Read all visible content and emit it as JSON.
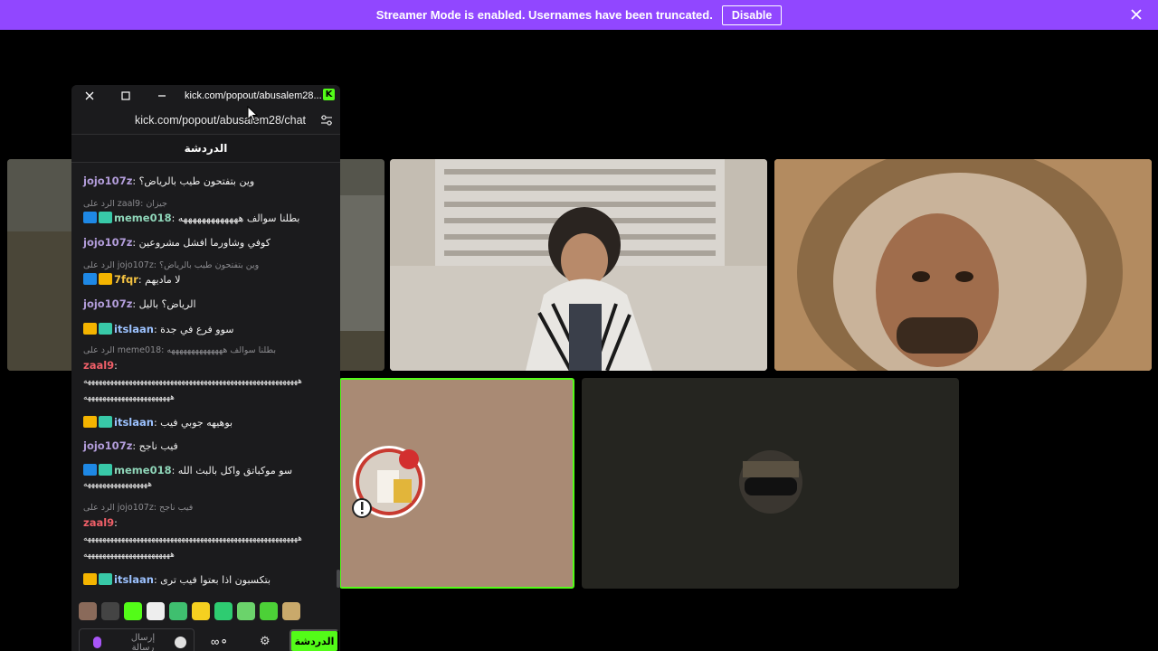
{
  "banner": {
    "message": "Streamer Mode is enabled. Usernames have been truncated.",
    "disable_label": "Disable",
    "color": "#9147ff"
  },
  "popout": {
    "window_title": "kick.com/popout/abusalem28...",
    "address": "kick.com/popout/abusalem28/chat",
    "chat_title": "الدردشة",
    "brand_color": "#53fc18"
  },
  "chat": {
    "messages": [
      {
        "user": "jojo107z",
        "text": "وين بتفتحون طيب بالرياض؟"
      },
      {
        "reply": "الرد على zaal9: جيزان"
      },
      {
        "user": "meme018",
        "text": "بطلنا سوالف هههههههههههههه"
      },
      {
        "user": "jojo107z",
        "text": "كوفي وشاورما افشل مشروعين"
      },
      {
        "reply": "الرد على jojo107z: وين بتفتحون طيب بالرياض؟"
      },
      {
        "user": "7fqr",
        "text": "لا ماديهم"
      },
      {
        "user": "jojo107z",
        "text": "الرياض؟ باليل"
      },
      {
        "user": "itslaan",
        "text": "سوو فرع في جدة"
      },
      {
        "reply": "الرد على meme018: بطلنا سوالف ههههههههههههههه"
      },
      {
        "user": "zaal9",
        "text": ""
      },
      {
        "long1": "هههههههههههههههههههههههههههههههههههههههههههههههههههههههههه"
      },
      {
        "long2": "هههههههههههههههههههههههه"
      },
      {
        "user": "itslaan",
        "text": "بوهيهه جوبي فيب"
      },
      {
        "user": "jojo107z",
        "text": "فيب ناجح"
      },
      {
        "user": "meme018",
        "text": "سو موكباتق واكل بالبث الله"
      },
      {
        "long3": "هههههههههههههههههه"
      },
      {
        "reply": "الرد على jojo107z: فيب ناجح"
      },
      {
        "user": "zaal9",
        "text": ""
      },
      {
        "long4": "هههههههههههههههههههههههههههههههههههههههههههههههههههههههههه"
      },
      {
        "long5": "هههههههههههههههههههههههه"
      },
      {
        "user": "itslaan",
        "text": "بتكسبون اذا بعتوا فيب ترى"
      }
    ],
    "input_placeholder": "إرسال رسالة",
    "send_label": "الدردشة"
  },
  "colors": {
    "accent": "#53fc18",
    "panel": "#1b1b1d"
  }
}
